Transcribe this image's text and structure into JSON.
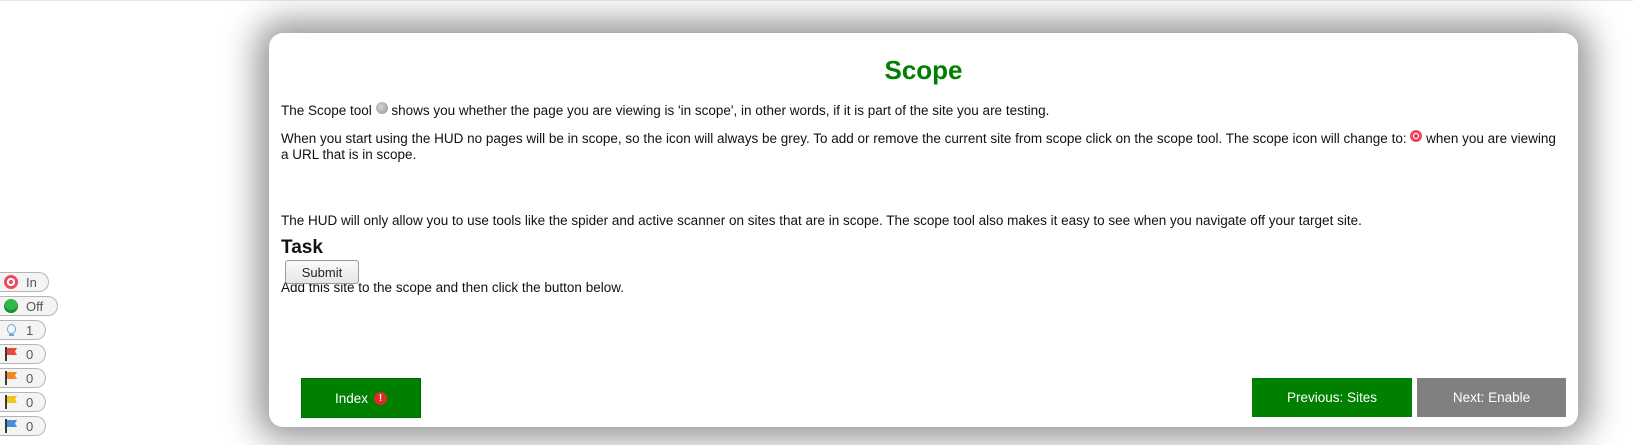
{
  "hud": {
    "scope": {
      "label": "In",
      "icon": "target-icon"
    },
    "break": {
      "label": "Off",
      "icon": "globe-icon"
    },
    "info": {
      "label": "1",
      "icon": "lightbulb-icon"
    },
    "alerts": [
      {
        "label": "0",
        "color": "#e84a3b",
        "icon": "red-flag-icon"
      },
      {
        "label": "0",
        "color": "#f08a24",
        "icon": "orange-flag-icon"
      },
      {
        "label": "0",
        "color": "#f2c41c",
        "icon": "yellow-flag-icon"
      },
      {
        "label": "0",
        "color": "#4a8fd6",
        "icon": "blue-flag-icon"
      }
    ]
  },
  "modal": {
    "title": "Scope",
    "p1_before": "The Scope tool",
    "p1_after": "shows you whether the page you are viewing is 'in scope', in other words, if it is part of the site you are testing.",
    "p2_before": "When you start using the HUD no pages will be in scope, so the icon will always be grey. To add or remove the current site from scope click on the scope tool. The scope icon will change to:",
    "p2_after": "when you are viewing a URL that is in scope.",
    "p3": "The HUD will only allow you to use tools like the spider and active scanner on sites that are in scope. The scope tool also makes it easy to see when you navigate off your target site.",
    "task_heading": "Task",
    "task_text": "Add this site to the scope and then click the button below.",
    "submit_label": "Submit",
    "index_label": "Index",
    "index_badge": "!",
    "prev_label": "Previous: Sites",
    "next_label": "Next: Enable",
    "colors": {
      "accent": "#008000",
      "disabled": "#808080"
    }
  }
}
